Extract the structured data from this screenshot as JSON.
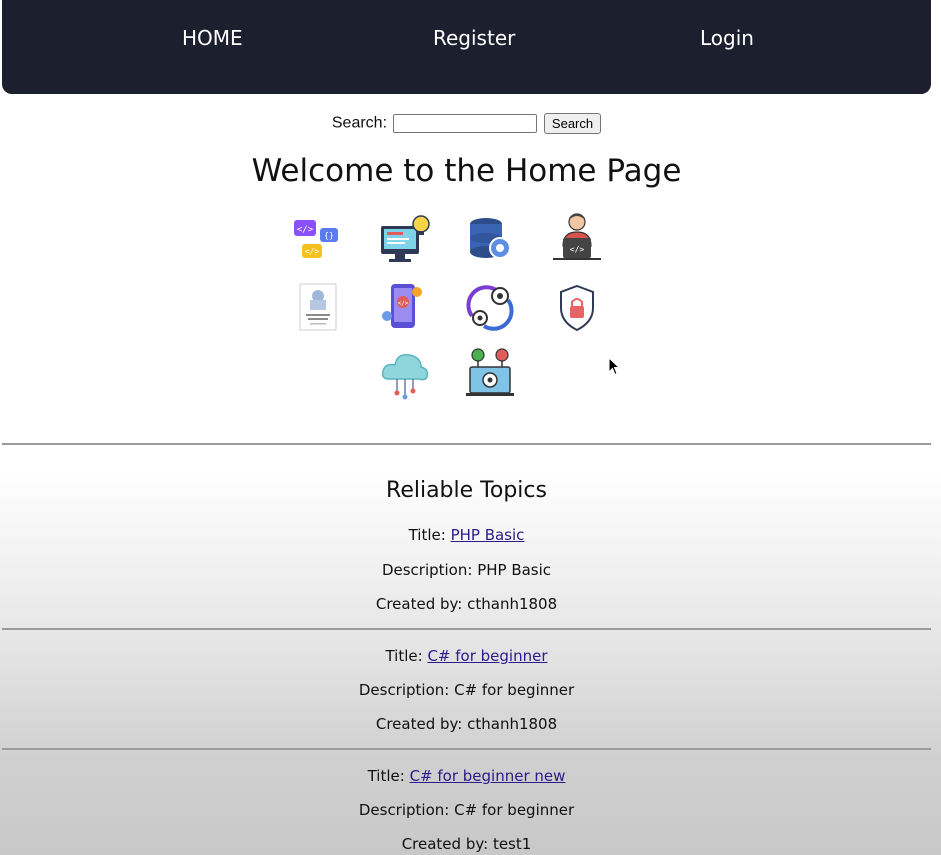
{
  "nav": {
    "home": "HOME",
    "register": "Register",
    "login": "Login",
    "background": "#1c1f2e"
  },
  "search": {
    "label": "Search:",
    "value": "",
    "button": "Search"
  },
  "page_title": "Welcome to the Home Page",
  "icons": [
    "code-chat-icon",
    "web-development-icon",
    "database-settings-icon",
    "developer-laptop-icon",
    "data-structures-algorithms-book-icon",
    "mobile-development-icon",
    "devops-cycle-icon",
    "security-shield-icon",
    "cloud-computing-icon",
    "testing-laptop-icon"
  ],
  "topics_title": "Reliable Topics",
  "topics": [
    {
      "title_label": "Title:",
      "title": "PHP Basic",
      "description": "Description: PHP Basic",
      "created_by": "Created by: cthanh1808"
    },
    {
      "title_label": "Title:",
      "title": "C# for beginner",
      "description": "Description: C# for beginner",
      "created_by": "Created by: cthanh1808"
    },
    {
      "title_label": "Title:",
      "title": "C# for beginner new",
      "description": "Description: C# for beginner",
      "created_by": "Created by: test1"
    }
  ],
  "colors": {
    "link": "#2a1a8a",
    "divider": "#9a9a9a"
  }
}
